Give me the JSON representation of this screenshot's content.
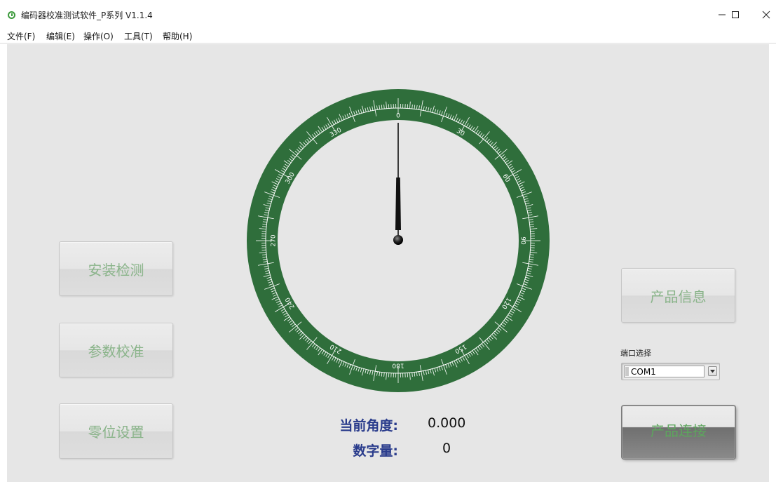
{
  "window": {
    "title": "编码器校准测试软件_P系列 V1.1.4",
    "controls": [
      "minimize-icon",
      "maximize-icon",
      "close-icon"
    ]
  },
  "menu": [
    "文件(F)",
    "编辑(E)",
    "操作(O)",
    "工具(T)",
    "帮助(H)"
  ],
  "buttons": {
    "install_check": "安装检测",
    "param_calibrate": "参数校准",
    "zero_setting": "零位设置",
    "product_info": "产品信息",
    "product_connect": "产品连接"
  },
  "port": {
    "label": "端口选择",
    "value": "COM1"
  },
  "readout": {
    "angle_label": "当前角度:",
    "angle_value": "0.000",
    "digital_label": "数字量:",
    "digital_value": "0"
  },
  "dial": {
    "angle_deg": 0,
    "scale_labels": [
      "0",
      "30",
      "60",
      "90",
      "120",
      "150",
      "180",
      "210",
      "240",
      "270",
      "300",
      "330"
    ]
  },
  "colors": {
    "dial_green": "#2f6e3b",
    "button_text": "#8ab48a",
    "readout_label": "#2a3c8c",
    "app_icon": "#3c9a3c"
  }
}
